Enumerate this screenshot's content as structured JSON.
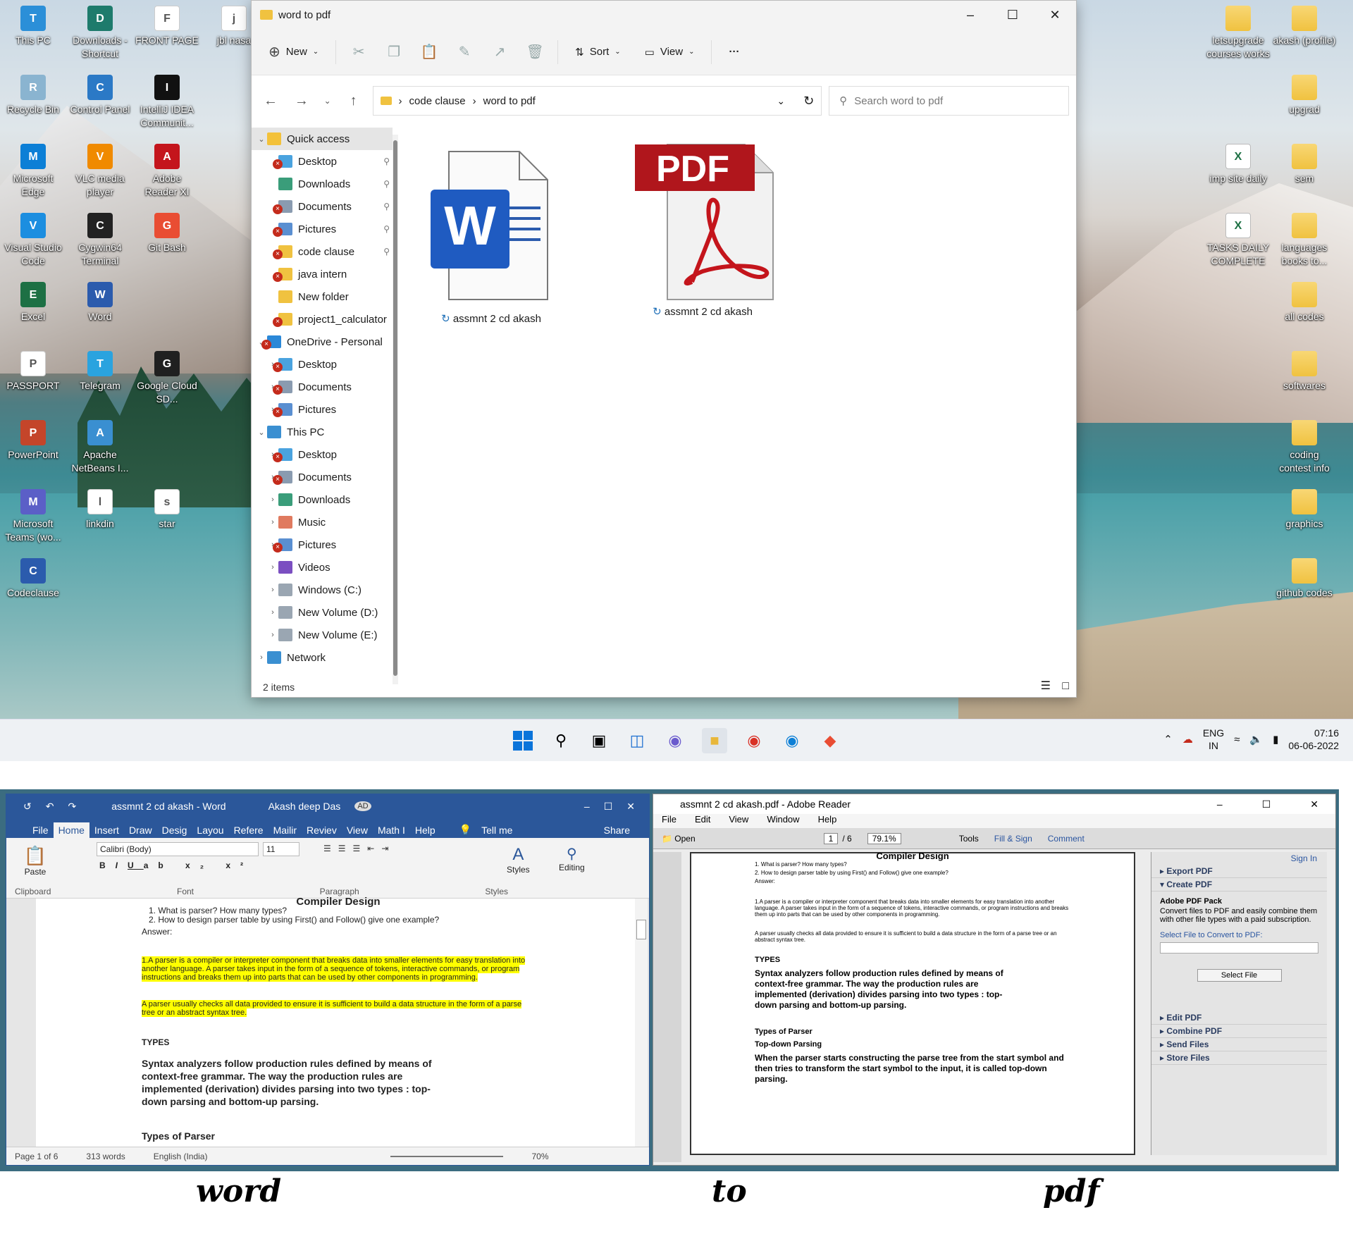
{
  "desktop": {
    "left_icons": [
      {
        "label": "This PC",
        "color": "#2b8fd8"
      },
      {
        "label": "Downloads - Shortcut",
        "color": "#1e7b6c"
      },
      {
        "label": "FRONT PAGE",
        "color": "#ffffff"
      },
      {
        "label": "jbl nasa",
        "color": "#ffffff"
      },
      {
        "label": "Recycle Bin",
        "color": "#8ab4d0"
      },
      {
        "label": "Control Panel",
        "color": "#2b79c6"
      },
      {
        "label": "IntelliJ IDEA Communit...",
        "color": "#111111"
      },
      {
        "label": "Microsoft Edge",
        "color": "#0c7fd6"
      },
      {
        "label": "VLC media player",
        "color": "#f08a00"
      },
      {
        "label": "Adobe Reader XI",
        "color": "#c4151c"
      },
      {
        "label": "Visual Studio Code",
        "color": "#1c8ee0"
      },
      {
        "label": "Cygwin64 Terminal",
        "color": "#222222"
      },
      {
        "label": "Git Bash",
        "color": "#e94d33"
      },
      {
        "label": "Excel",
        "color": "#1d7044"
      },
      {
        "label": "Word",
        "color": "#2b5bad"
      },
      {
        "label": "PASSPORT",
        "color": "#ffffff"
      },
      {
        "label": "Telegram",
        "color": "#2aa3df"
      },
      {
        "label": "Google Cloud SD...",
        "color": "#202020"
      },
      {
        "label": "PowerPoint",
        "color": "#c4452a"
      },
      {
        "label": "Apache NetBeans I...",
        "color": "#3a8fd1"
      },
      {
        "label": "Microsoft Teams (wo...",
        "color": "#5b5fc7"
      },
      {
        "label": "linkdin",
        "color": "#ffffff"
      },
      {
        "label": "star",
        "color": "#ffffff"
      },
      {
        "label": "Codeclause",
        "color": "#2b5bad"
      }
    ],
    "right_icons": [
      {
        "label": "letsupgrade courses works"
      },
      {
        "label": "akash (profile)"
      },
      {
        "label": "upgrad"
      },
      {
        "label": "imp site daily"
      },
      {
        "label": "sem"
      },
      {
        "label": "TASKS DAILY COMPLETE"
      },
      {
        "label": "languages books to..."
      },
      {
        "label": "all codes"
      },
      {
        "label": "softwares"
      },
      {
        "label": "coding contest info"
      },
      {
        "label": "graphics"
      },
      {
        "label": "github codes"
      }
    ]
  },
  "explorer": {
    "title": "word to pdf",
    "toolbar": {
      "new": "New",
      "sort": "Sort",
      "view": "View",
      "more": "···"
    },
    "breadcrumb": [
      "code clause",
      "word to pdf"
    ],
    "search_placeholder": "Search word to pdf",
    "nav": {
      "quick_access": "Quick access",
      "quick_items": [
        "Desktop",
        "Downloads",
        "Documents",
        "Pictures",
        "code clause",
        "java intern",
        "New folder",
        "project1_calculator"
      ],
      "onedrive": "OneDrive - Personal",
      "onedrive_items": [
        "Desktop",
        "Documents",
        "Pictures"
      ],
      "this_pc": "This PC",
      "pc_items": [
        "Desktop",
        "Documents",
        "Downloads",
        "Music",
        "Pictures",
        "Videos",
        "Windows (C:)",
        "New Volume (D:)",
        "New Volume (E:)"
      ],
      "network": "Network"
    },
    "files": [
      {
        "name": "assmnt 2 cd akash",
        "type": "word"
      },
      {
        "name": "assmnt 2 cd akash",
        "type": "pdf",
        "badge": "PDF"
      }
    ],
    "status": "2 items"
  },
  "taskbar": {
    "lang": "ENG",
    "region": "IN",
    "time": "07:16",
    "date": "06-06-2022"
  },
  "word": {
    "title": "assmnt 2 cd akash  -  Word",
    "user": "Akash deep Das",
    "user_initials": "AD",
    "tabs": [
      "File",
      "Home",
      "Insert",
      "Draw",
      "Desig",
      "Layou",
      "Refere",
      "Mailir",
      "Reviev",
      "View",
      "Math I",
      "Help"
    ],
    "tell_me": "Tell me",
    "share": "Share",
    "font": "Calibri (Body)",
    "size": "11",
    "groups": [
      "Clipboard",
      "Font",
      "Paragraph",
      "Styles"
    ],
    "paste": "Paste",
    "styles": "Styles",
    "editing": "Editing",
    "heading": "Compiler Design",
    "q1": "1.   What is parser? How many types?",
    "q2": "2.   How to design parser table by using First() and Follow() give one example?",
    "answer": "Answer:",
    "p1": "1.A parser is a compiler or interpreter component that breaks data into smaller elements for easy translation into another language. A parser takes input in the form of a sequence of tokens, interactive commands, or program instructions and breaks them up into parts that can be used by other components in programming.",
    "p2": "A parser usually checks all data provided to ensure it is sufficient to build a data structure in the form of a parse tree or an abstract syntax tree.",
    "types": "TYPES",
    "p3": "Syntax analyzers follow production rules defined by means of context-free grammar. The way the production rules are implemented (derivation) divides parsing into two types : top-down parsing and bottom-up parsing.",
    "types_of_parser": "Types of Parser",
    "status_page": "Page 1 of 6",
    "status_words": "313 words",
    "status_lang": "English (India)",
    "zoom": "70%"
  },
  "pdf": {
    "title": "assmnt 2 cd akash.pdf - Adobe Reader",
    "menu": [
      "File",
      "Edit",
      "View",
      "Window",
      "Help"
    ],
    "open": "Open",
    "page": "1",
    "pages": "/ 6",
    "zoom": "79.1%",
    "tools": "Tools",
    "fill_sign": "Fill & Sign",
    "comment": "Comment",
    "sign_in": "Sign In",
    "side": [
      "Export PDF",
      "Create PDF"
    ],
    "pack_title": "Adobe PDF Pack",
    "pack_text": "Convert files to PDF and easily combine them with other file types with a paid subscription.",
    "select_label": "Select File to Convert to PDF:",
    "select_btn": "Select File",
    "side_more": [
      "Edit PDF",
      "Combine PDF",
      "Send Files",
      "Store Files"
    ],
    "heading": "Compiler Design",
    "types_of_parser": "Types of Parser",
    "topdown": "Top-down Parsing",
    "p4": "When the parser starts constructing the parse tree from the start symbol and then tries to transform the start symbol to the input, it is called top-down parsing."
  },
  "caption": {
    "w1": "word",
    "w2": "to",
    "w3": "pdf"
  }
}
